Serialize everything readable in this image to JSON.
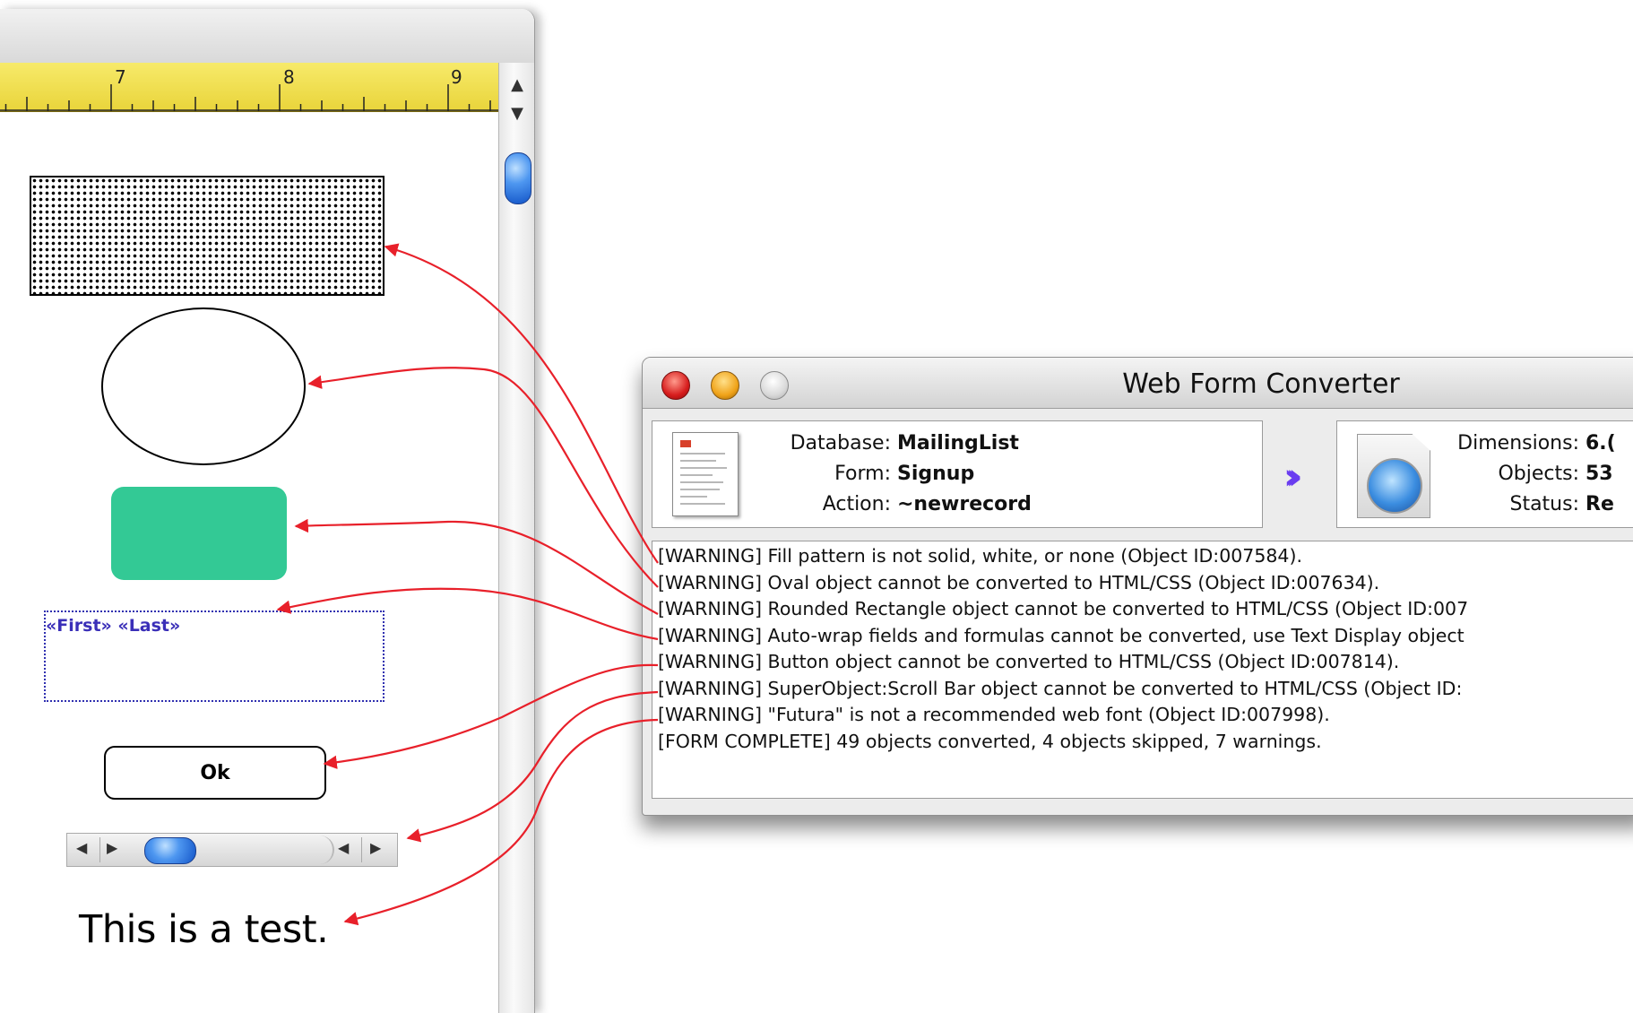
{
  "form_window": {
    "ruler_numbers": [
      "7",
      "8",
      "9"
    ],
    "merge_field_text": "«First» «Last»",
    "ok_button_label": "Ok",
    "test_text": "This is a test."
  },
  "converter": {
    "title": "Web Form Converter",
    "source": {
      "database_label": "Database:",
      "database_value": "MailingList",
      "form_label": "Form:",
      "form_value": "Signup",
      "action_label": "Action:",
      "action_value": "~newrecord"
    },
    "output": {
      "dimensions_label": "Dimensions:",
      "dimensions_value": "6.(",
      "objects_label": "Objects:",
      "objects_value": "53",
      "status_label": "Status:",
      "status_value": "Re"
    },
    "log": [
      "[WARNING] Fill pattern is not solid, white, or none (Object ID:007584).",
      "[WARNING] Oval object cannot be converted to HTML/CSS (Object ID:007634).",
      "[WARNING] Rounded Rectangle object cannot be converted to HTML/CSS (Object ID:007",
      "[WARNING] Auto-wrap fields and formulas cannot be converted, use Text Display object",
      "[WARNING] Button object cannot be converted to HTML/CSS (Object ID:007814).",
      "[WARNING] SuperObject:Scroll Bar object cannot be converted to HTML/CSS (Object ID:",
      "[WARNING] \"Futura\" is not a recommended web font (Object ID:007998).",
      "[FORM COMPLETE] 49 objects converted, 4 objects skipped, 7 warnings."
    ]
  },
  "colors": {
    "arrow": "#e8202a",
    "rounded_rect_fill": "#33c995",
    "merge_field_text": "#3a2fb8",
    "ruler": "#f2e354"
  }
}
